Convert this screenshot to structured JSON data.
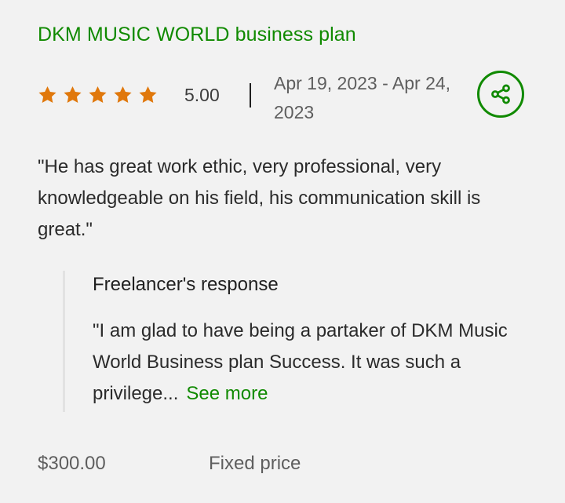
{
  "job": {
    "title": "DKM MUSIC WORLD business plan",
    "rating": "5.00",
    "stars": 5,
    "date_range": "Apr 19, 2023 - Apr 24, 2023"
  },
  "feedback": {
    "text": "\"He has great work ethic, very professional, very knowledgeable on his field, his communication skill is great.\""
  },
  "response": {
    "heading": "Freelancer's response",
    "text": "\"I am glad to have being a partaker of DKM Music World Business plan Success. It was such a privilege...",
    "see_more_label": "See more"
  },
  "payment": {
    "amount": "$300.00",
    "type": "Fixed price"
  },
  "icons": {
    "star": "star-icon",
    "share": "share-icon"
  },
  "colors": {
    "accent": "#108a00",
    "star": "#e0780c",
    "background": "#f2f2f2"
  }
}
